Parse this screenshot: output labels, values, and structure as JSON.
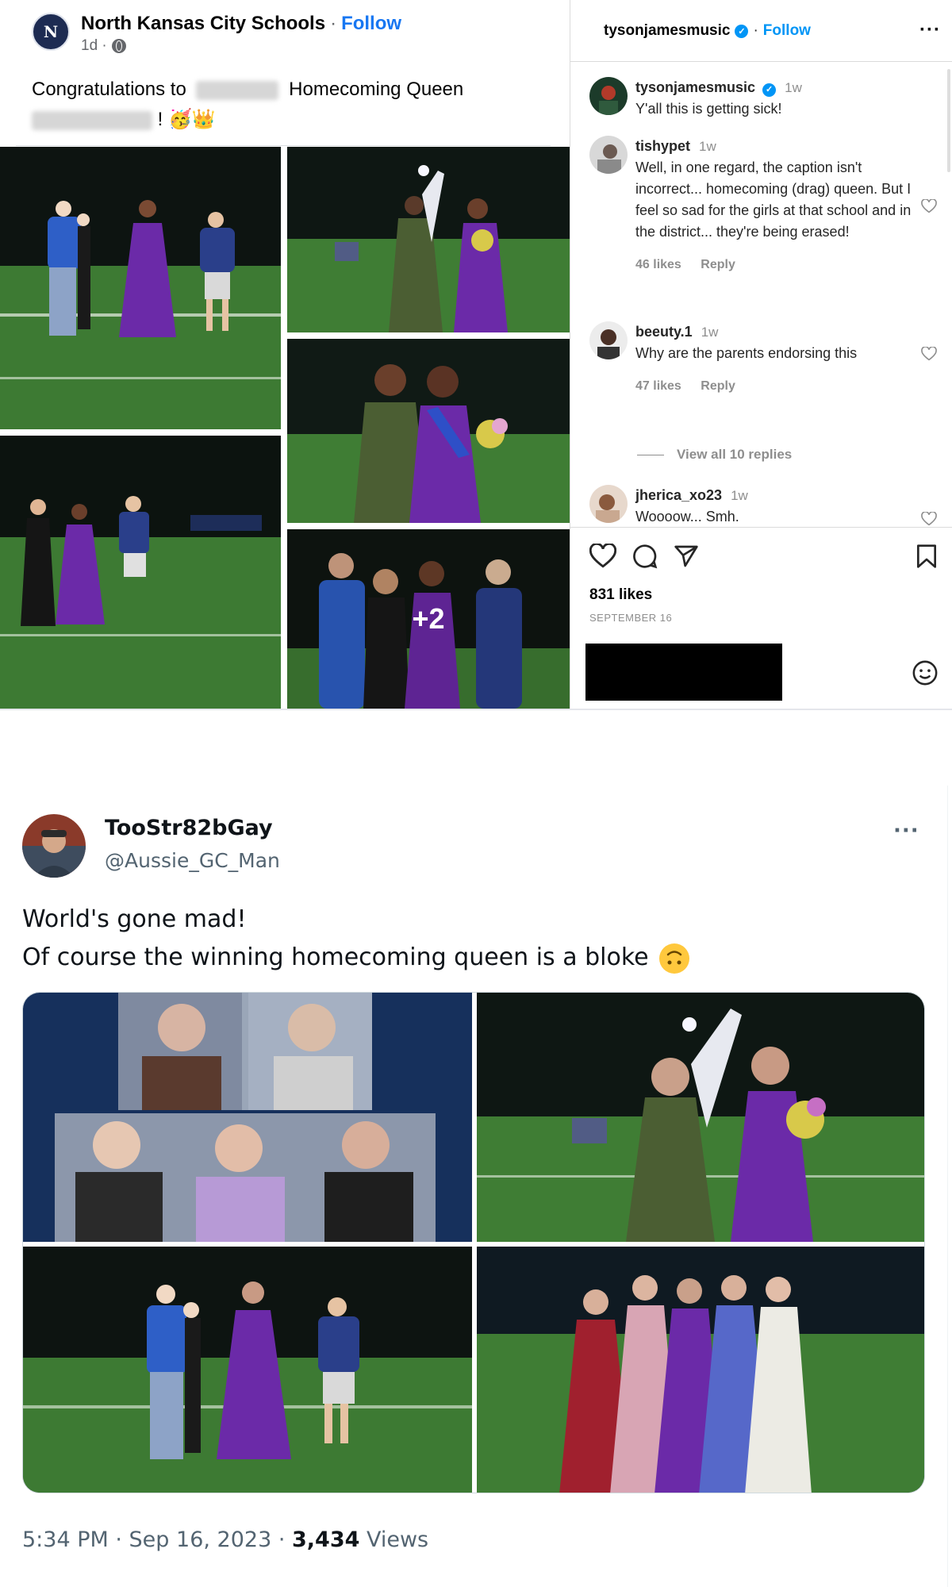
{
  "facebook": {
    "page_name": "North Kansas City Schools",
    "separator": "·",
    "follow_label": "Follow",
    "time": "1d ·",
    "avatar_letter": "N",
    "text_prefix": "Congratulations to",
    "text_middle": "Homecoming Queen",
    "text_suffix": "! 🥳👑",
    "overflow_count": "+2"
  },
  "instagram": {
    "header_user": "tysonjamesmusic",
    "header_dot": "·",
    "follow_label": "Follow",
    "more_label": "···",
    "comments": [
      {
        "user": "tysonjamesmusic",
        "time": "1w",
        "text": "Y'all this is getting sick!",
        "likes": "",
        "reply": ""
      },
      {
        "user": "tishypet",
        "time": "1w",
        "text": "Well, in one regard, the caption isn't incorrect... homecoming (drag) queen. But I feel so sad for the girls at that school and in the district... they're being erased!",
        "likes": "46 likes",
        "reply": "Reply"
      },
      {
        "user": "beeuty.1",
        "time": "1w",
        "text": "Why are the parents endorsing this",
        "likes": "47 likes",
        "reply": "Reply"
      },
      {
        "user": "jherica_xo23",
        "time": "1w",
        "text": "Woooow... Smh.",
        "likes": "",
        "reply": ""
      }
    ],
    "view_replies": "View all 10 replies",
    "likes_count": "831 likes",
    "date": "SEPTEMBER 16"
  },
  "twitter": {
    "display_name": "TooStr82bGay",
    "handle": "@Aussie_GC_Man",
    "more_label": "···",
    "text_line1": "World's gone mad!",
    "text_line2": "Of course the winning homecoming queen is a bloke",
    "timestamp": "5:34 PM · Sep 16, 2023 · ",
    "views_count": "3,434",
    "views_label": " Views"
  },
  "icons": {
    "like": "heart-icon",
    "comment": "comment-bubble-icon",
    "share": "paper-plane-icon",
    "save": "bookmark-icon",
    "emoji": "smiley-icon",
    "verified": "verified-badge-icon",
    "more": "ellipsis-icon"
  },
  "colors": {
    "facebook_blue": "#1877f2",
    "instagram_blue": "#0095f6",
    "field_green": "#3f7d34",
    "night_sky": "#0d1411",
    "gown_purple": "#6b2aa8",
    "jersey_blue": "#2e5fc7"
  }
}
